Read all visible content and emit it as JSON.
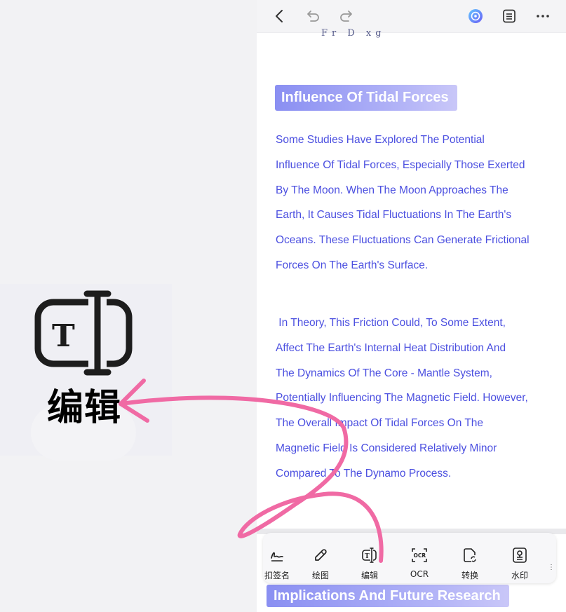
{
  "callout": {
    "label": "编辑",
    "icon": "text-edit-icon"
  },
  "topbar": {
    "back_icon": "chevron-left-icon",
    "undo_icon": "undo-icon",
    "redo_icon": "redo-icon",
    "ai_icon": "ai-assistant-icon",
    "outline_icon": "outline-list-icon",
    "more_icon": "more-horizontal-icon"
  },
  "document": {
    "formula_fragment": "Fr D   xg",
    "heading": "Influence Of Tidal Forces",
    "paragraph1": [
      "Some Studies Have Explored The Potential",
      "Influence Of Tidal Forces, Especially Those Exerted",
      "By The Moon. When The Moon Approaches The",
      "Earth, It Causes Tidal Fluctuations In The Earth's",
      "Oceans. These Fluctuations Can Generate Frictional",
      "Forces On The Earth's Surface."
    ],
    "paragraph2": [
      " In Theory, This Friction Could, To Some Extent,",
      "Affect The Earth's Internal Heat Distribution And",
      "The Dynamics Of The Core - Mantle System,",
      "Potentially Influencing The Magnetic Field. However,",
      "The Overall Impact Of Tidal Forces On The",
      "Magnetic Field Is Considered Relatively Minor",
      "Compared To The Dynamo Process."
    ],
    "heading2": "Implications And Future Research"
  },
  "toolbar": {
    "items": [
      {
        "label": "扣签名",
        "icon": "signature-icon"
      },
      {
        "label": "绘图",
        "icon": "pen-draw-icon"
      },
      {
        "label": "编辑",
        "icon": "text-edit-icon"
      },
      {
        "label": "OCR",
        "icon": "ocr-icon"
      },
      {
        "label": "转换",
        "icon": "convert-icon"
      },
      {
        "label": "水印",
        "icon": "watermark-icon"
      }
    ],
    "more": "⋮"
  },
  "colors": {
    "accent": "#4b4fe0",
    "heading_gradient_start": "#8a8ff2",
    "arrow": "#f06aa4"
  }
}
